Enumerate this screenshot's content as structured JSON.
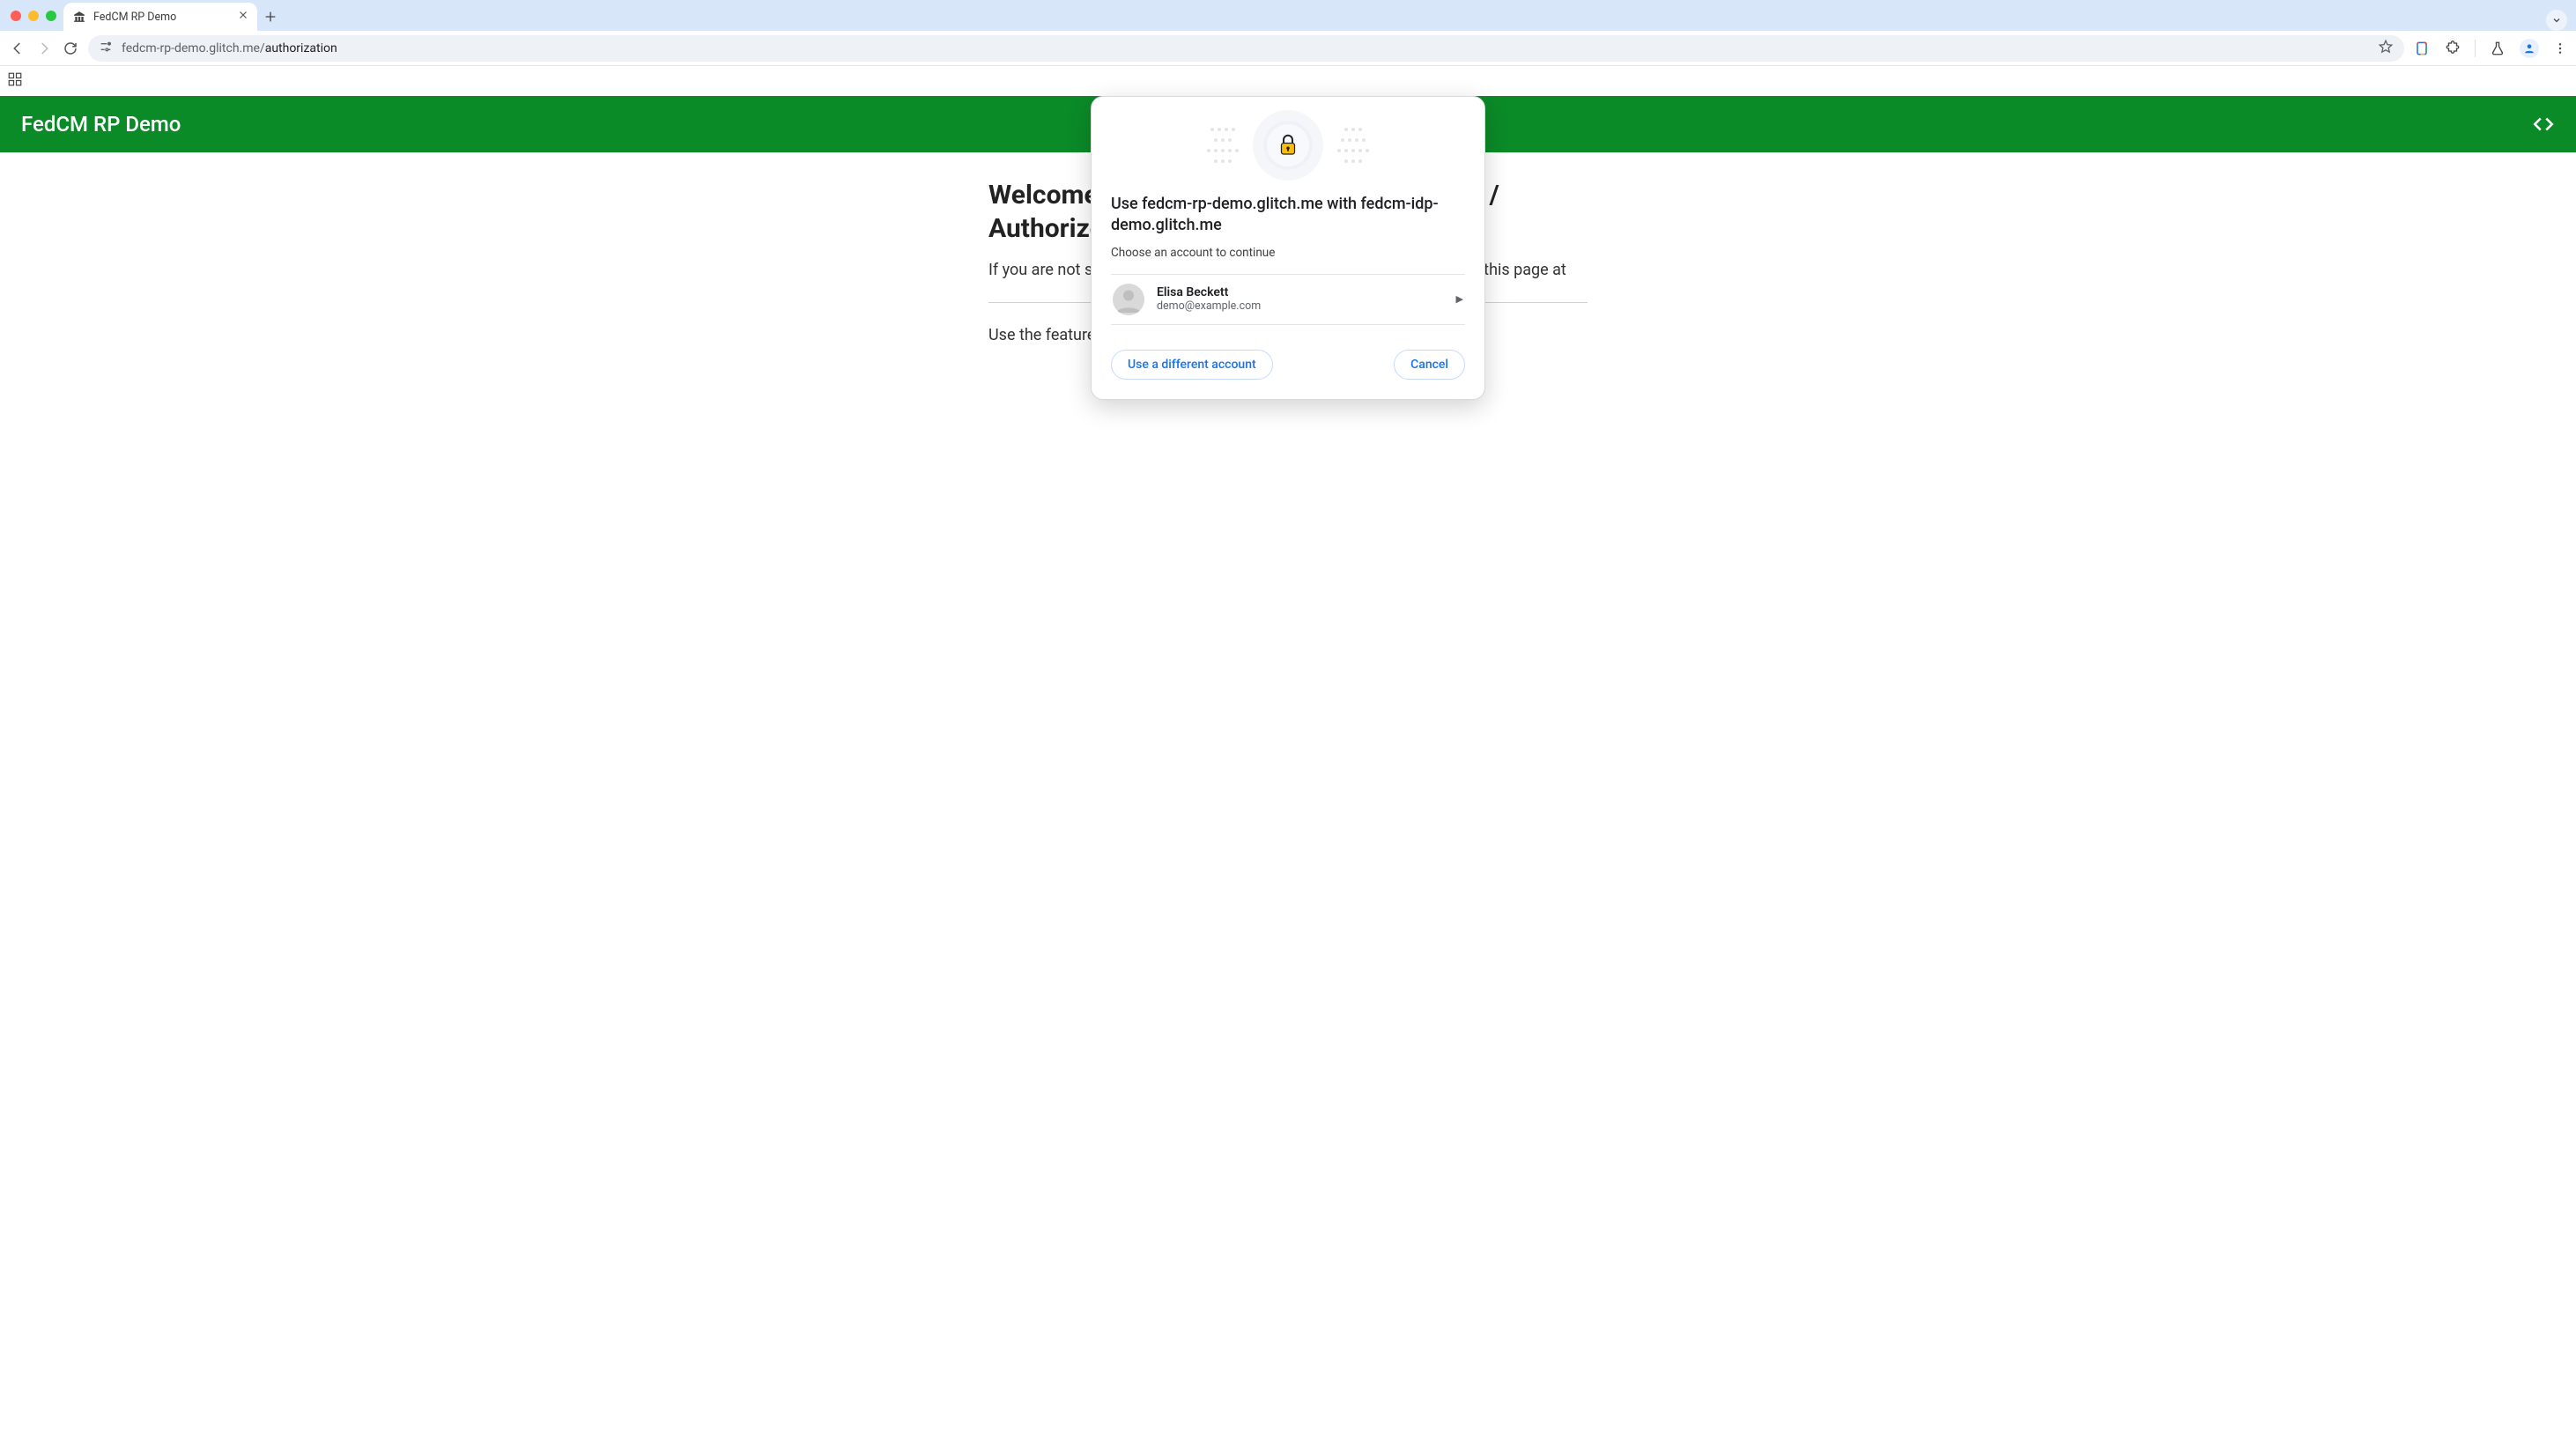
{
  "browser": {
    "tab": {
      "title": "FedCM RP Demo"
    },
    "url_dim": "fedcm-rp-demo.glitch.me/",
    "url_path": "authorization"
  },
  "page": {
    "hero_title": "FedCM RP Demo",
    "heading_line1": "Welcome to FedCM RP Demo",
    "heading_line2": "Continue as / Authorize",
    "para1": "If you are not signed in to the IDP yet, you can do so without sign-in on this page at",
    "para2": "Use the feature and the browser displays the FedCM Authorize dialog."
  },
  "modal": {
    "title": "Use fedcm-rp-demo.glitch.me with fedcm-idp-demo.glitch.me",
    "subtitle": "Choose an account to continue",
    "accounts": [
      {
        "name": "Elisa Beckett",
        "email": "demo@example.com"
      }
    ],
    "btn_other": "Use a different account",
    "btn_cancel": "Cancel"
  }
}
